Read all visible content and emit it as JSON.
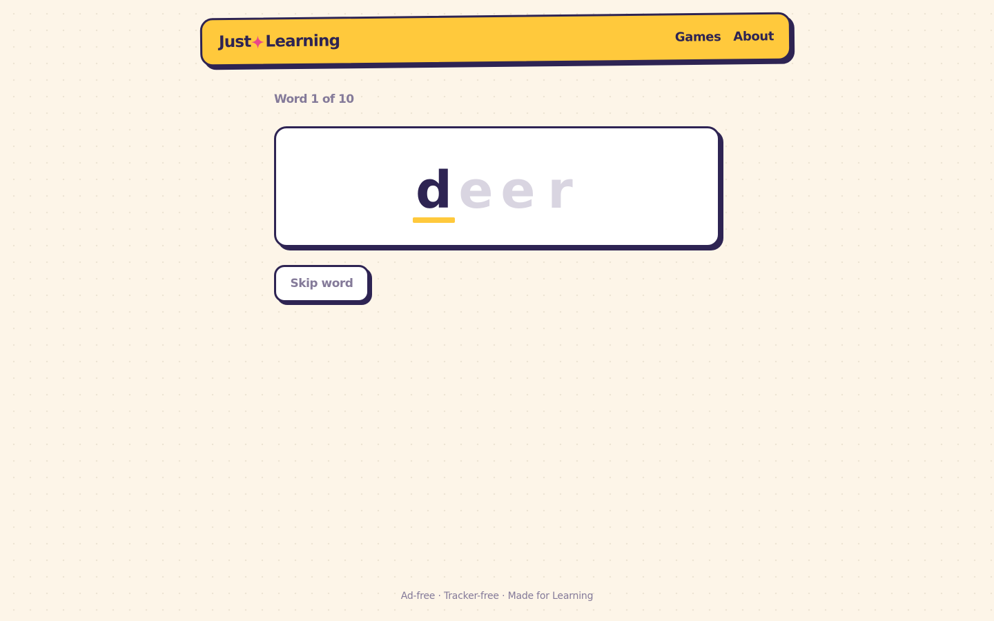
{
  "brand": {
    "part1": "Just",
    "part2": "Learning",
    "icon": "sparkle-icon",
    "accent_color": "#e8488a"
  },
  "nav": {
    "items": [
      {
        "label": "Games"
      },
      {
        "label": "About"
      }
    ]
  },
  "game": {
    "progress_text": "Word 1 of 10",
    "letters": [
      {
        "char": "d",
        "state": "active"
      },
      {
        "char": "e",
        "state": "pending"
      },
      {
        "char": "e",
        "state": "pending"
      },
      {
        "char": "r",
        "state": "pending"
      }
    ],
    "skip_label": "Skip word"
  },
  "footer": {
    "text": "Ad-free · Tracker-free · Made for Learning"
  },
  "colors": {
    "ink": "#2e2453",
    "header_yellow": "#ffc93c",
    "muted": "#847a99",
    "pending_letter": "#d9d5e1",
    "background": "#fdf5e8"
  }
}
